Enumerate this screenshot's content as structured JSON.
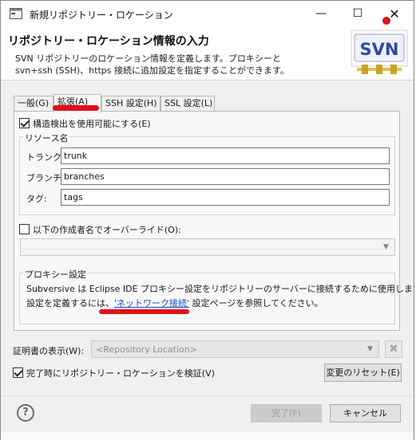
{
  "window": {
    "title": "新規リポジトリー・ロケーション",
    "minimize_glyph": "—",
    "maximize_glyph": "☐",
    "close_glyph": "✕"
  },
  "header": {
    "title": "リポジトリー・ロケーション情報の入力",
    "desc_line1": "SVN リポジトリーのロケーション情報を定義します。プロキシーと",
    "desc_line2": "svn+ssh (SSH)、https 接続に追加設定を指定することができます。",
    "logo_text": "SVN"
  },
  "tabs": [
    {
      "label": "一般(G)"
    },
    {
      "label": "拡張(A)"
    },
    {
      "label": "SSH 設定(H)"
    },
    {
      "label": "SSL 設定(L)"
    }
  ],
  "advanced": {
    "structure_detection_label": "構造検出を使用可能にする(E)",
    "structure_detection_checked": true,
    "resource_group_title": "リソース名",
    "trunk_label": "トランク:",
    "trunk_value": "trunk",
    "branches_label": "ブランチ:",
    "branches_value": "branches",
    "tags_label": "タグ:",
    "tags_value": "tags",
    "override_author_label": "以下の作成者名でオーバーライド(O):",
    "override_author_checked": false,
    "proxy_group_title": "プロキシー設定",
    "proxy_text_line1": "Subversive は Eclipse IDE プロキシー設定をリポジトリーのサーバーに接続するために使用します。",
    "proxy_text_line2_prefix": "設定を定義するには、",
    "proxy_link": "'ネットワーク接続'",
    "proxy_text_line2_suffix": " 設定ページを参照してください。"
  },
  "certificate": {
    "label": "証明書の表示(W):",
    "placeholder": "<Repository Location>"
  },
  "validate": {
    "label": "完了時にリポジトリー・ロケーションを検証(V)",
    "checked": true
  },
  "buttons": {
    "reset": "変更のリセット(E)",
    "finish": "完了(F)",
    "cancel": "キャンセル",
    "help": "?"
  },
  "colors": {
    "accent_red": "#e0101a",
    "link_blue": "#1550c8"
  }
}
